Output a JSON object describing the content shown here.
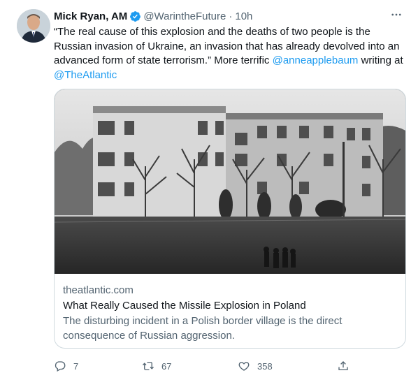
{
  "tweet": {
    "author_name": "Mick Ryan, AM",
    "handle": "@WarintheFuture",
    "separator": "·",
    "time": "10h",
    "text_part1": "“The real cause of this explosion and the deaths of two people is the Russian invasion of Ukraine, an invasion that has already devolved into an advanced form of state terrorism.” More terrific ",
    "mention1": "@anneapplebaum",
    "text_part2": " writing at ",
    "mention2": "@TheAtlantic",
    "icons": {
      "verified": "verified-badge-icon",
      "more": "more-options-icon"
    },
    "accent_color": "#1d9bf0"
  },
  "card": {
    "domain": "theatlantic.com",
    "title": "What Really Caused the Missile Explosion in Poland",
    "description": "The disturbing incident in a Polish border village is the direct consequence of Russian aggression.",
    "image": "black-and-white photo of apartment building with people walking in field"
  },
  "actions": {
    "reply_count": "7",
    "retweet_count": "67",
    "like_count": "358",
    "icons": [
      "reply-icon",
      "retweet-icon",
      "like-icon",
      "share-icon"
    ]
  }
}
